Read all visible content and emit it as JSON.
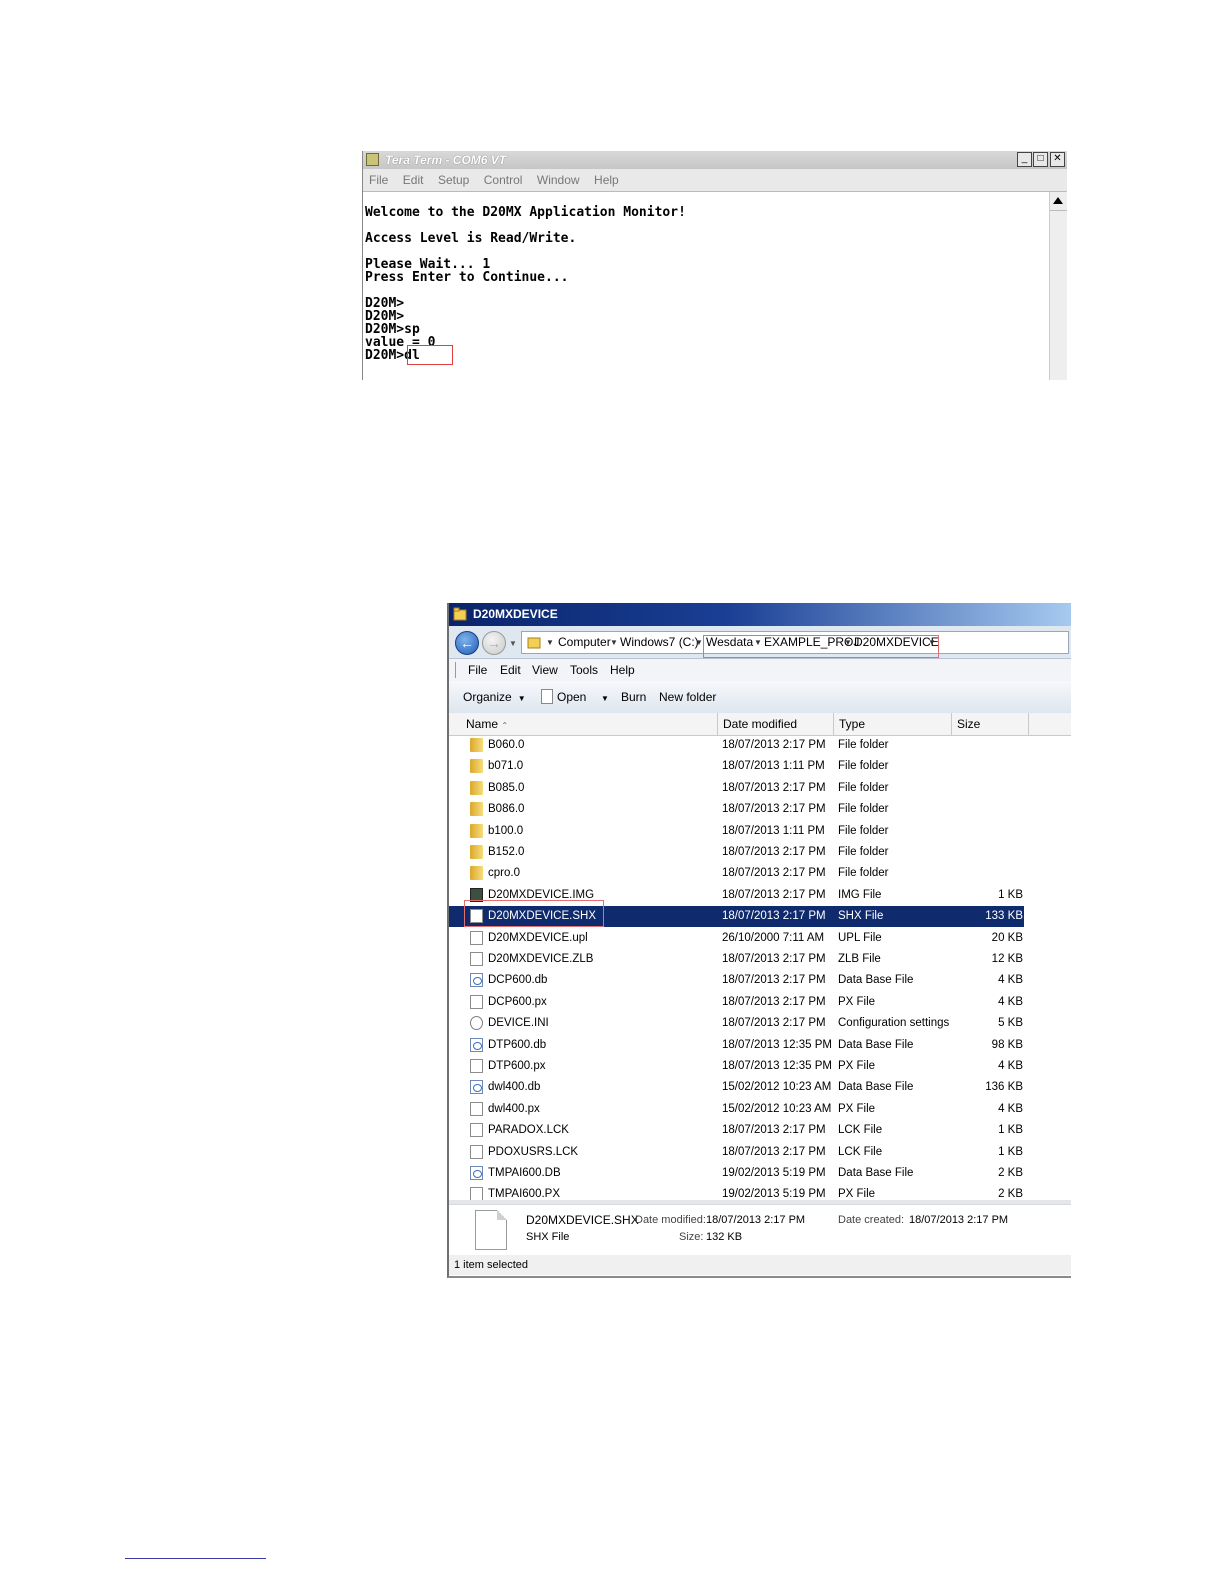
{
  "teraterm": {
    "title": "Tera Term - COM6 VT",
    "window_buttons": [
      "_",
      "□",
      "✕"
    ],
    "menu": [
      "File",
      "Edit",
      "Setup",
      "Control",
      "Window",
      "Help"
    ],
    "lines": [
      "Welcome to the D20MX Application Monitor!",
      "",
      "Access Level is Read/Write.",
      "",
      "Please Wait... 1",
      "Press Enter to Continue...",
      "",
      "D20M>",
      "D20M>",
      "D20M>sp",
      "value = 0",
      "D20M>dl"
    ],
    "icon": "teraterm-app-icon"
  },
  "explorer": {
    "title": "D20MXDEVICE",
    "breadcrumbs": [
      "Computer",
      "Windows7 (C:)",
      "Wesdata",
      "EXAMPLE_PROJ",
      "D20MXDEVICE"
    ],
    "menu": [
      "File",
      "Edit",
      "View",
      "Tools",
      "Help"
    ],
    "toolbar": {
      "organize": "Organize",
      "open": "Open",
      "burn": "Burn",
      "new_folder": "New folder"
    },
    "columns": {
      "name": "Name",
      "date": "Date modified",
      "type": "Type",
      "size": "Size"
    },
    "files": [
      {
        "name": "B060.0",
        "date": "18/07/2013 2:17 PM",
        "type": "File folder",
        "size": "",
        "icon": "folder-icon"
      },
      {
        "name": "b071.0",
        "date": "18/07/2013 1:11 PM",
        "type": "File folder",
        "size": "",
        "icon": "folder-icon"
      },
      {
        "name": "B085.0",
        "date": "18/07/2013 2:17 PM",
        "type": "File folder",
        "size": "",
        "icon": "folder-icon"
      },
      {
        "name": "B086.0",
        "date": "18/07/2013 2:17 PM",
        "type": "File folder",
        "size": "",
        "icon": "folder-icon"
      },
      {
        "name": "b100.0",
        "date": "18/07/2013 1:11 PM",
        "type": "File folder",
        "size": "",
        "icon": "folder-icon"
      },
      {
        "name": "B152.0",
        "date": "18/07/2013 2:17 PM",
        "type": "File folder",
        "size": "",
        "icon": "folder-icon"
      },
      {
        "name": "cpro.0",
        "date": "18/07/2013 2:17 PM",
        "type": "File folder",
        "size": "",
        "icon": "folder-icon"
      },
      {
        "name": "D20MXDEVICE.IMG",
        "date": "18/07/2013 2:17 PM",
        "type": "IMG File",
        "size": "1 KB",
        "icon": "img-file-icon"
      },
      {
        "name": "D20MXDEVICE.SHX",
        "date": "18/07/2013 2:17 PM",
        "type": "SHX File",
        "size": "133 KB",
        "icon": "file-icon",
        "selected": true
      },
      {
        "name": "D20MXDEVICE.upl",
        "date": "26/10/2000 7:11 AM",
        "type": "UPL File",
        "size": "20 KB",
        "icon": "file-icon"
      },
      {
        "name": "D20MXDEVICE.ZLB",
        "date": "18/07/2013 2:17 PM",
        "type": "ZLB File",
        "size": "12 KB",
        "icon": "file-icon"
      },
      {
        "name": "DCP600.db",
        "date": "18/07/2013 2:17 PM",
        "type": "Data Base File",
        "size": "4 KB",
        "icon": "database-file-icon"
      },
      {
        "name": "DCP600.px",
        "date": "18/07/2013 2:17 PM",
        "type": "PX File",
        "size": "4 KB",
        "icon": "file-icon"
      },
      {
        "name": "DEVICE.INI",
        "date": "18/07/2013 2:17 PM",
        "type": "Configuration settings",
        "size": "5 KB",
        "icon": "settings-file-icon"
      },
      {
        "name": "DTP600.db",
        "date": "18/07/2013 12:35 PM",
        "type": "Data Base File",
        "size": "98 KB",
        "icon": "database-file-icon"
      },
      {
        "name": "DTP600.px",
        "date": "18/07/2013 12:35 PM",
        "type": "PX File",
        "size": "4 KB",
        "icon": "file-icon"
      },
      {
        "name": "dwl400.db",
        "date": "15/02/2012 10:23 AM",
        "type": "Data Base File",
        "size": "136 KB",
        "icon": "database-file-icon"
      },
      {
        "name": "dwl400.px",
        "date": "15/02/2012 10:23 AM",
        "type": "PX File",
        "size": "4 KB",
        "icon": "file-icon"
      },
      {
        "name": "PARADOX.LCK",
        "date": "18/07/2013 2:17 PM",
        "type": "LCK File",
        "size": "1 KB",
        "icon": "file-icon"
      },
      {
        "name": "PDOXUSRS.LCK",
        "date": "18/07/2013 2:17 PM",
        "type": "LCK File",
        "size": "1 KB",
        "icon": "file-icon"
      },
      {
        "name": "TMPAI600.DB",
        "date": "19/02/2013 5:19 PM",
        "type": "Data Base File",
        "size": "2 KB",
        "icon": "database-file-icon"
      },
      {
        "name": "TMPAI600.PX",
        "date": "19/02/2013 5:19 PM",
        "type": "PX File",
        "size": "2 KB",
        "icon": "file-icon"
      }
    ],
    "details": {
      "name": "D20MXDEVICE.SHX",
      "type": "SHX File",
      "date_modified_label": "Date modified:",
      "date_modified": "18/07/2013 2:17 PM",
      "date_created_label": "Date created:",
      "date_created": "18/07/2013 2:17 PM",
      "size_label": "Size:",
      "size": "132 KB"
    },
    "status": "1 item selected"
  },
  "colors": {
    "selection": "#0f2b6d",
    "highlight_box": "#e07070",
    "explorer_title_start": "#0a246a"
  }
}
